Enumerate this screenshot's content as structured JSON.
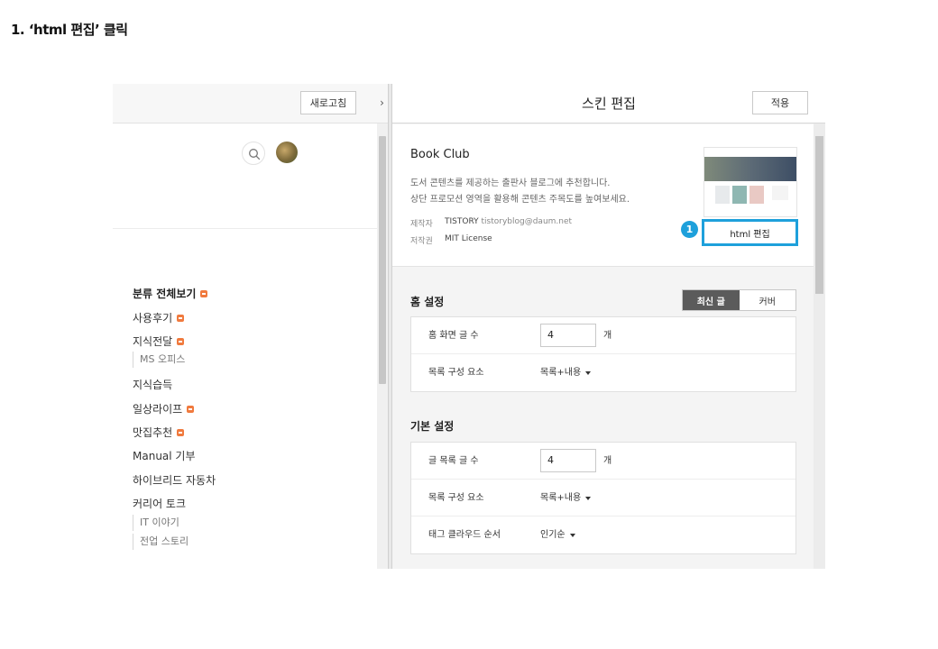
{
  "step_title": "1. ‘html 편집’ 클릭",
  "left_panel": {
    "refresh_label": "새로고침",
    "arrow_glyph": "›",
    "categories": [
      {
        "label": "분류 전체보기",
        "new": true,
        "bold": true
      },
      {
        "label": "사용후기",
        "new": true
      },
      {
        "label": "지식전달",
        "new": true
      },
      {
        "label": "MS 오피스",
        "sub": true
      },
      {
        "label": "지식습득"
      },
      {
        "label": "일상라이프",
        "new": true
      },
      {
        "label": "맛집추천",
        "new": true
      },
      {
        "label": "Manual 기부"
      },
      {
        "label": "하이브리드 자동차"
      },
      {
        "label": "커리어 토크"
      },
      {
        "label": "IT 이야기",
        "sub": true
      },
      {
        "label": "전업 스토리",
        "sub": true
      }
    ]
  },
  "right_panel": {
    "title": "스킨 편집",
    "apply_label": "적용",
    "skin": {
      "name": "Book Club",
      "desc_line1": "도서 콘텐츠를 제공하는 출판사 블로그에 추천합니다.",
      "desc_line2": "상단 프로모션 영역을 활용해 콘텐츠 주목도를 높여보세요.",
      "maker_label": "제작자",
      "maker_value": "TISTORY",
      "maker_email": "tistoryblog@daum.net",
      "license_label": "저작권",
      "license_value": "MIT License",
      "html_edit_label": "html 편집",
      "step_number": "1"
    },
    "home_settings": {
      "title": "홈 설정",
      "toggle_on": "최신 글",
      "toggle_off": "커버",
      "posts_label": "홈 화면 글 수",
      "posts_value": "4",
      "posts_unit": "개",
      "list_label": "목록 구성 요소",
      "list_value": "목록+내용"
    },
    "basic_settings": {
      "title": "기본 설정",
      "posts_label": "글 목록 글 수",
      "posts_value": "4",
      "posts_unit": "개",
      "list_label": "목록 구성 요소",
      "list_value": "목록+내용",
      "tag_label": "태그 클라우드 순서",
      "tag_value": "인기순"
    }
  },
  "colors": {
    "highlight": "#1ea0db",
    "new_badge": "#f07a3e",
    "toggle_active": "#5b5b5b"
  }
}
